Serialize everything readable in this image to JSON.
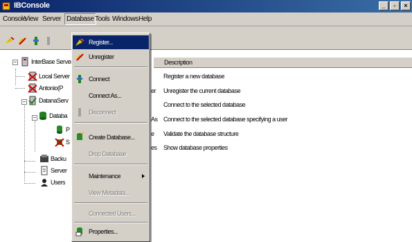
{
  "window": {
    "title": "IBConsole"
  },
  "menubar": [
    "Console",
    "View",
    "Server",
    "Database",
    "Tools",
    "Windows",
    "Help"
  ],
  "tree": [
    {
      "label": "InterBase Servers",
      "icon": "servers-icon"
    },
    {
      "label": "Local Server",
      "icon": "server-disconnected-icon"
    },
    {
      "label": "Antonio(P",
      "icon": "server-disconnected-icon"
    },
    {
      "label": "DatanaServ",
      "icon": "server-connected-icon"
    },
    {
      "label": "Databa",
      "icon": "databases-icon"
    },
    {
      "label": "P",
      "icon": "database-icon"
    },
    {
      "label": "S",
      "icon": "database-disconnected-icon"
    },
    {
      "label": "Backu",
      "icon": "backup-icon"
    },
    {
      "label": "Server",
      "icon": "server-log-icon"
    },
    {
      "label": "Users",
      "icon": "users-icon"
    }
  ],
  "list": {
    "columns": [
      "Description"
    ],
    "rows": [
      {
        "action": "",
        "description": "Register a new database"
      },
      {
        "action": "er",
        "description": "Unregister the current database"
      },
      {
        "action": "",
        "description": "Connect to the selected database"
      },
      {
        "action": "As",
        "description": "Connect to the selected database specifying a user"
      },
      {
        "action": "e",
        "description": "Validate the database structure"
      },
      {
        "action": "es",
        "description": "Show database properties"
      }
    ]
  },
  "database_menu": [
    {
      "label": "Register...",
      "icon": "register-icon",
      "state": "selected"
    },
    {
      "label": "Unregister",
      "icon": "unregister-icon",
      "state": "normal"
    },
    {
      "label": "Connect",
      "icon": "connect-icon",
      "state": "normal"
    },
    {
      "label": "Connect As...",
      "icon": "",
      "state": "normal"
    },
    {
      "label": "Disconnect",
      "icon": "disconnect-icon",
      "state": "disabled"
    },
    {
      "label": "Create Database...",
      "icon": "create-database-icon",
      "state": "normal"
    },
    {
      "label": "Drop Database",
      "icon": "",
      "state": "disabled"
    },
    {
      "label": "Maintenance",
      "icon": "",
      "state": "normal",
      "submenu": true
    },
    {
      "label": "View Metadata...",
      "icon": "",
      "state": "disabled"
    },
    {
      "label": "Connected Users...",
      "icon": "",
      "state": "disabled"
    },
    {
      "label": "Properties...",
      "icon": "properties-icon",
      "state": "normal"
    }
  ],
  "colors": {
    "title_bar": "#0a246a",
    "selection": "#0a246a",
    "chrome": "#d4d0c8"
  }
}
